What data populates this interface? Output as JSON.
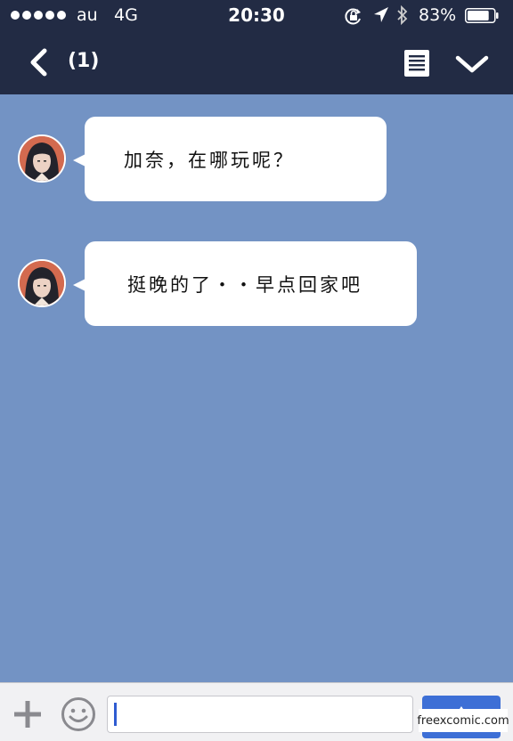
{
  "status_bar": {
    "carrier": "au",
    "network": "4G",
    "time": "20:30",
    "battery": "83%",
    "battery_level": 0.83,
    "icons": [
      "signal-dots-icon",
      "rotation-lock-icon",
      "location-arrow-icon",
      "bluetooth-icon",
      "battery-icon"
    ]
  },
  "header": {
    "unread_count": "(1)",
    "icons": [
      "back-chevron-icon",
      "note-icon",
      "chevron-down-icon"
    ],
    "color": "#222b44"
  },
  "messages": [
    {
      "text": "加奈，在哪玩呢？",
      "avatar": "avatar-icon"
    },
    {
      "text": "挺晚的了・・早点回家吧",
      "avatar": "avatar-icon"
    }
  ],
  "input_bar": {
    "icons": [
      "plus-icon",
      "emoji-icon",
      "send-icon"
    ],
    "value": ""
  },
  "watermark": "freexcomic.com",
  "colors": {
    "chat_background": "#7393c4",
    "bubble": "#ffffff",
    "send_button": "#3d6fd6"
  }
}
